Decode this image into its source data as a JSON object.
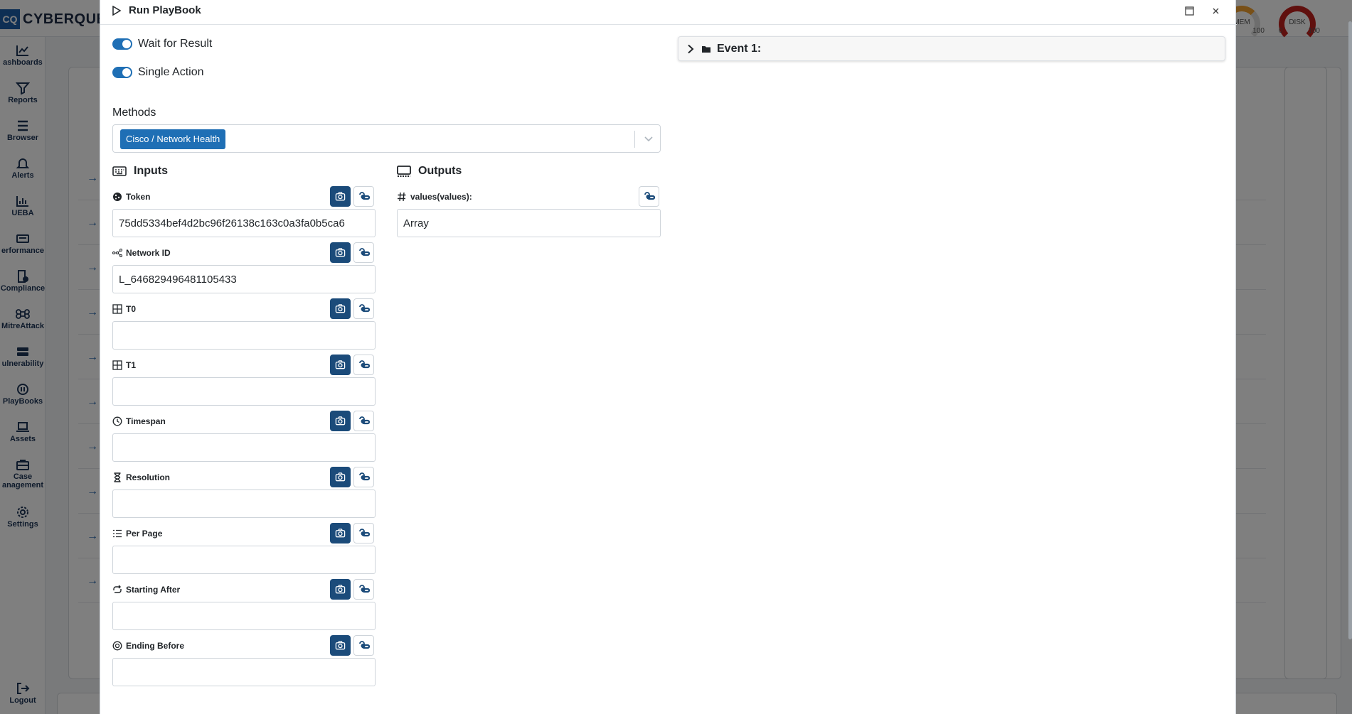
{
  "background": {
    "logo_mark": "CQ",
    "logo_word": "CYBERQUES",
    "gauges": [
      {
        "label": "MEM",
        "min": "",
        "max": "100"
      },
      {
        "label": "DISK",
        "min": "0",
        "max": "100"
      }
    ],
    "nav": [
      {
        "label": "ashboards",
        "icon": "chart-line-icon"
      },
      {
        "label": "Reports",
        "icon": "filter-icon"
      },
      {
        "label": "Browser",
        "icon": "list-icon"
      },
      {
        "label": "Alerts",
        "icon": "bell-icon"
      },
      {
        "label": "UEBA",
        "icon": "chart-bar-icon"
      },
      {
        "label": "erformance",
        "icon": "keyboard-icon"
      },
      {
        "label": "Compliance",
        "icon": "file-check-icon"
      },
      {
        "label": "MitreAttack",
        "icon": "command-icon"
      },
      {
        "label": "ulnerability",
        "icon": "server-icon"
      },
      {
        "label": "PlayBooks",
        "icon": "playbook-icon"
      },
      {
        "label": "Assets",
        "icon": "laptop-icon"
      },
      {
        "label": "Case",
        "label2": "anagement",
        "icon": "briefcase-icon"
      },
      {
        "label": "Settings",
        "icon": "gear-icon"
      },
      {
        "label": "Logout",
        "icon": "logout-icon"
      }
    ]
  },
  "modal": {
    "title": "Run PlayBook",
    "wait_for_result": "Wait for Result",
    "single_action": "Single Action",
    "methods_label": "Methods",
    "methods_selected": "Cisco / Network Health",
    "inputs_title": "Inputs",
    "outputs_title": "Outputs",
    "inputs": [
      {
        "label": "Token",
        "value": "75dd5334bef4d2bc96f26138c163c0a3fa0b5ca6",
        "icon": "cookie-icon"
      },
      {
        "label": "Network ID",
        "value": "L_646829496481105433",
        "icon": "network-icon"
      },
      {
        "label": "T0",
        "value": "",
        "icon": "table-icon"
      },
      {
        "label": "T1",
        "value": "",
        "icon": "table-icon"
      },
      {
        "label": "Timespan",
        "value": "",
        "icon": "clock-icon"
      },
      {
        "label": "Resolution",
        "value": "",
        "icon": "hourglass-icon"
      },
      {
        "label": "Per Page",
        "value": "",
        "icon": "list-ordered-icon"
      },
      {
        "label": "Starting After",
        "value": "",
        "icon": "arrow-repeat-icon"
      },
      {
        "label": "Ending Before",
        "value": "",
        "icon": "record-icon"
      }
    ],
    "outputs": [
      {
        "label": "values(values):",
        "value": "Array",
        "icon": "hash-icon"
      }
    ],
    "event_title": "Event 1:"
  }
}
